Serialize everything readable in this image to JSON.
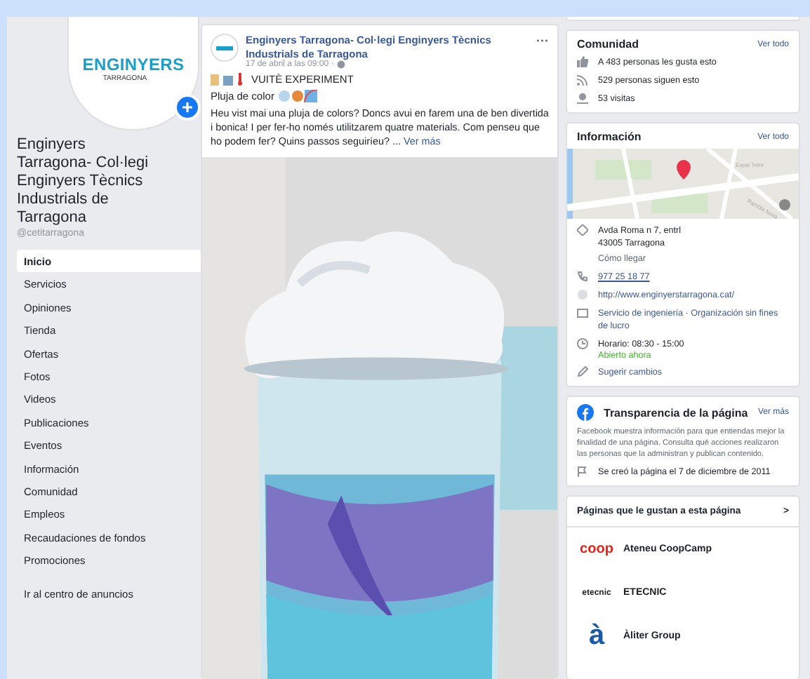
{
  "profile": {
    "logo_title": "ENGINYERS",
    "logo_subtitle": "TARRAGONA",
    "name": "Enginyers Tarragona- Col·legi Enginyers Tècnics Industrials de Tarragona",
    "handle": "@cetitarragona"
  },
  "nav": [
    {
      "label": "Inicio",
      "selected": true
    },
    {
      "label": "Servicios",
      "selected": false
    },
    {
      "label": "Opiniones",
      "selected": false
    },
    {
      "label": "Tienda",
      "selected": false
    },
    {
      "label": "Ofertas",
      "selected": false
    },
    {
      "label": "Fotos",
      "selected": false
    },
    {
      "label": "Videos",
      "selected": false
    },
    {
      "label": "Publicaciones",
      "selected": false
    },
    {
      "label": "Eventos",
      "selected": false
    },
    {
      "label": "Información",
      "selected": false
    },
    {
      "label": "Comunidad",
      "selected": false
    },
    {
      "label": "Empleos",
      "selected": false
    },
    {
      "label": "Recaudaciones de fondos",
      "selected": false
    },
    {
      "label": "Promociones",
      "selected": false
    }
  ],
  "ads_link": "Ir al centro de anuncios",
  "post": {
    "author": "Enginyers Tarragona- Col·legi Enginyers Tècnics Industrials de Tarragona",
    "menu": "···",
    "time": "17 de abril a las 09:00 ·",
    "headline": "VUITÈ EXPERIMENT",
    "subtitle": "Pluja de color",
    "body": "Heu vist mai una pluja de colors? Doncs avui en farem una de ben divertida i bonica! I per fer-ho només utilitzarem quatre materials. Com penseu que ho podem fer? Quins passos seguiríeu? ...",
    "more": "Ver más"
  },
  "community": {
    "title": "Comunidad",
    "link": "Ver todo",
    "rows": [
      {
        "kind": "likes",
        "text": "A 483 personas les gusta esto"
      },
      {
        "kind": "followers",
        "text": "529 personas siguen esto"
      },
      {
        "kind": "visits",
        "text": "53 visitas"
      }
    ]
  },
  "info": {
    "title": "Información",
    "link": "Ver todo",
    "map_labels": [
      "Espai Tetre",
      "Rambla Nova"
    ],
    "address": [
      "Avda Roma n 7, entrl",
      "43005 Tarragona"
    ],
    "directions": "Cómo llegar",
    "phone": "977 25 18 77",
    "website": "http://www.enginyerstarragona.cat/",
    "category": "Servicio de ingeniería · Organización sin fines de lucro",
    "hours": "Horario: 08:30 - 15:00",
    "open_now": "Abierto ahora",
    "suggest": "Sugerir cambios"
  },
  "transparency": {
    "title": "Transparencia de la página",
    "link": "Ver más",
    "text": "Facebook muestra información para que entiendas mejor la finalidad de una página. Consulta qué acciones realizaron las personas que la administran y publican contenido.",
    "created": "Se creó la página el 7 de diciembre de 2011"
  },
  "liked_pages": {
    "title": "Páginas que le gustan a esta página",
    "chevron": ">",
    "pages": [
      {
        "kind": "coop",
        "logo": "coop",
        "name": "Ateneu CoopCamp"
      },
      {
        "kind": "etecnic",
        "logo": "etecnic",
        "name": "ETECNIC"
      },
      {
        "kind": "aliter",
        "logo": "à",
        "name": "Àliter Group"
      }
    ]
  }
}
